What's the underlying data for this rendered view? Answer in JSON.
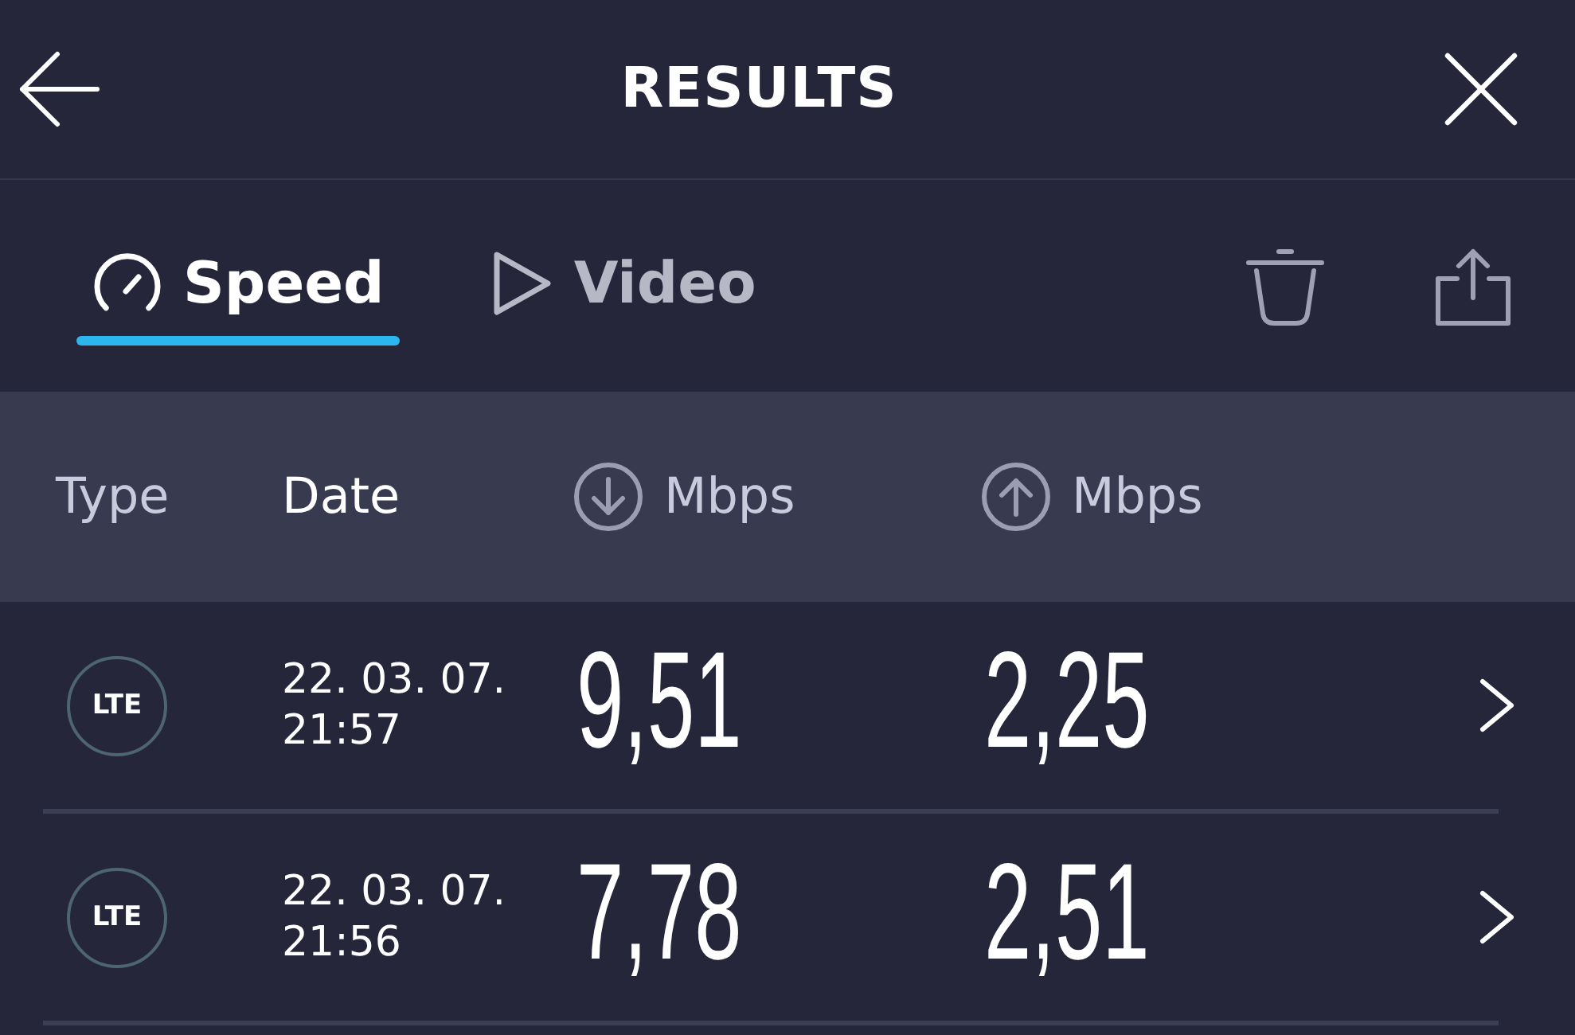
{
  "header": {
    "title": "RESULTS"
  },
  "tabs": [
    {
      "label": "Speed",
      "kind": "speed",
      "selected": true
    },
    {
      "label": "Video",
      "kind": "video",
      "selected": false
    }
  ],
  "table": {
    "columns": [
      {
        "label": "Type",
        "kind": "text",
        "selected": false
      },
      {
        "label": "Date",
        "kind": "text",
        "selected": true
      },
      {
        "label": "Mbps",
        "kind": "download",
        "selected": false
      },
      {
        "label": "Mbps",
        "kind": "upload",
        "selected": false
      }
    ],
    "rows": [
      {
        "type": "LTE",
        "date": "22. 03. 07.",
        "time": "21:57",
        "download": "9,51",
        "upload": "2,25"
      },
      {
        "type": "LTE",
        "date": "22. 03. 07.",
        "time": "21:56",
        "download": "7,78",
        "upload": "2,51"
      }
    ]
  }
}
